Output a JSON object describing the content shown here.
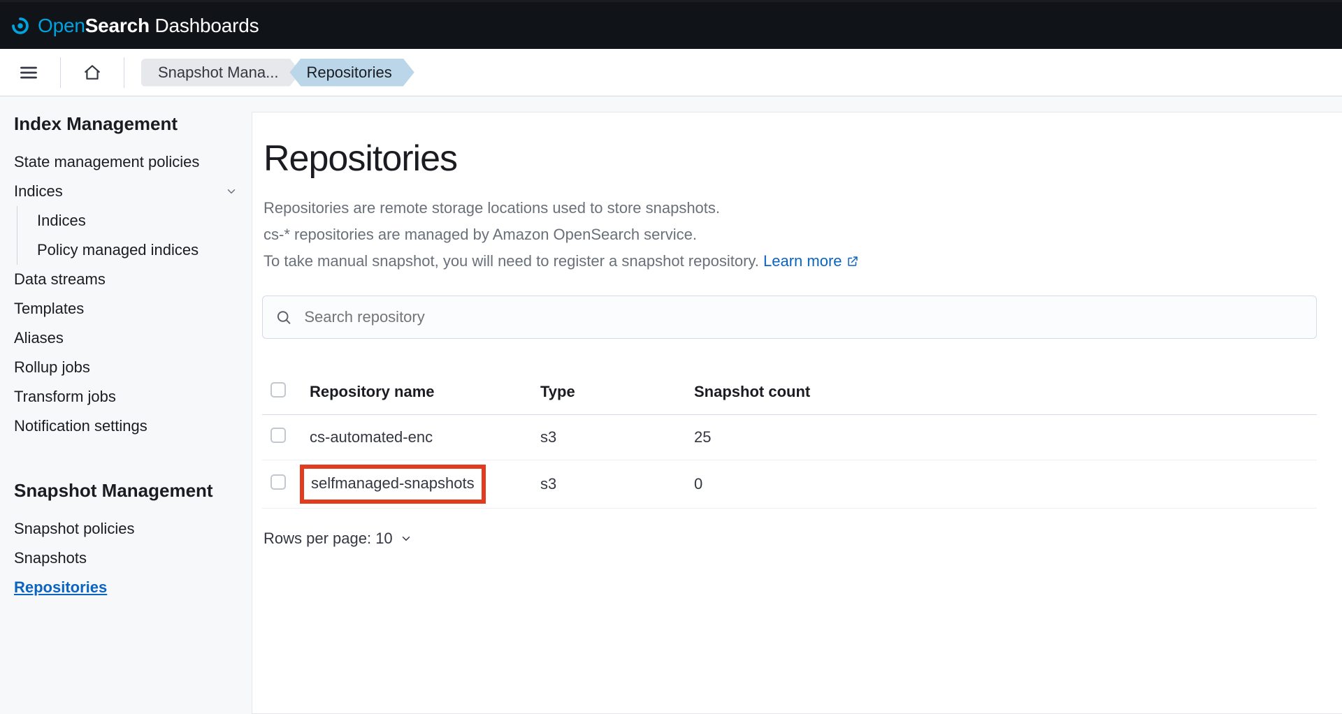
{
  "brand": {
    "open": "Open",
    "search": "Search",
    "dash": " Dashboards"
  },
  "breadcrumbs": {
    "item1": "Snapshot Mana...",
    "item2": "Repositories"
  },
  "sidebar": {
    "heading1": "Index Management",
    "items1": [
      "State management policies",
      "Indices",
      "Data streams",
      "Templates",
      "Aliases",
      "Rollup jobs",
      "Transform jobs",
      "Notification settings"
    ],
    "indices_sub": [
      "Indices",
      "Policy managed indices"
    ],
    "heading2": "Snapshot Management",
    "items2": [
      "Snapshot policies",
      "Snapshots",
      "Repositories"
    ]
  },
  "page": {
    "title": "Repositories",
    "desc1": "Repositories are remote storage locations used to store snapshots.",
    "desc2": "cs-* repositories are managed by Amazon OpenSearch service.",
    "desc3_a": "To take manual snapshot, you will need to register a snapshot repository. ",
    "desc3_link": "Learn more",
    "search_placeholder": "Search repository",
    "columns": {
      "name": "Repository name",
      "type": "Type",
      "count": "Snapshot count"
    },
    "rows": [
      {
        "name": "cs-automated-enc",
        "type": "s3",
        "count": "25"
      },
      {
        "name": "selfmanaged-snapshots",
        "type": "s3",
        "count": "0"
      }
    ],
    "rpp": "Rows per page: 10"
  }
}
